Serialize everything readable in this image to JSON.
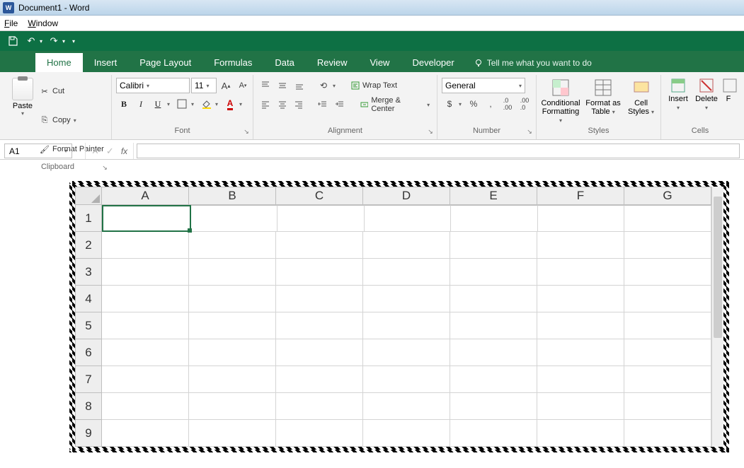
{
  "titlebar": {
    "title": "Document1 - Word",
    "icon_label": "W"
  },
  "menubar": {
    "file": "File",
    "window": "Window"
  },
  "tabs": {
    "home": "Home",
    "insert": "Insert",
    "page_layout": "Page Layout",
    "formulas": "Formulas",
    "data": "Data",
    "review": "Review",
    "view": "View",
    "developer": "Developer",
    "tellme": "Tell me what you want to do"
  },
  "clipboard": {
    "paste": "Paste",
    "cut": "Cut",
    "copy": "Copy",
    "format_painter": "Format Painter",
    "group_label": "Clipboard"
  },
  "font": {
    "name": "Calibri",
    "size": "11",
    "group_label": "Font"
  },
  "alignment": {
    "wrap_text": "Wrap Text",
    "merge_center": "Merge & Center",
    "group_label": "Alignment"
  },
  "number": {
    "format": "General",
    "group_label": "Number"
  },
  "styles": {
    "conditional": "Conditional Formatting",
    "format_as_table": "Format as Table",
    "cell_styles": "Cell Styles",
    "group_label": "Styles"
  },
  "cells": {
    "insert": "Insert",
    "delete": "Delete",
    "format": "F",
    "group_label": "Cells"
  },
  "namebox": {
    "value": "A1"
  },
  "sheet": {
    "columns": [
      "A",
      "B",
      "C",
      "D",
      "E",
      "F",
      "G"
    ],
    "rows": [
      "1",
      "2",
      "3",
      "4",
      "5",
      "6",
      "7",
      "8",
      "9"
    ],
    "active_cell": "A1"
  }
}
